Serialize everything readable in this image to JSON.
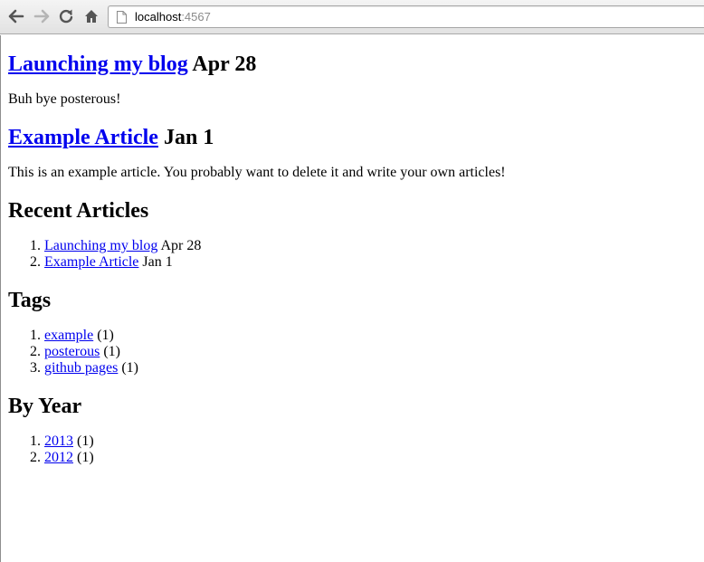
{
  "browser": {
    "url_host": "localhost",
    "url_port": ":4567"
  },
  "articles": [
    {
      "title": "Launching my blog",
      "date": "Apr 28",
      "body": "Buh bye posterous!"
    },
    {
      "title": "Example Article",
      "date": "Jan 1",
      "body": "This is an example article. You probably want to delete it and write your own articles!"
    }
  ],
  "recent": {
    "heading": "Recent Articles",
    "items": [
      {
        "title": "Launching my blog",
        "date": "Apr 28"
      },
      {
        "title": "Example Article",
        "date": "Jan 1"
      }
    ]
  },
  "tags": {
    "heading": "Tags",
    "items": [
      {
        "name": "example",
        "count": "(1)"
      },
      {
        "name": "posterous",
        "count": "(1)"
      },
      {
        "name": "github pages",
        "count": "(1)"
      }
    ]
  },
  "by_year": {
    "heading": "By Year",
    "items": [
      {
        "year": "2013",
        "count": "(1)"
      },
      {
        "year": "2012",
        "count": "(1)"
      }
    ]
  },
  "icons": {
    "back": "back-arrow-icon",
    "forward": "forward-arrow-icon",
    "reload": "reload-icon",
    "home": "home-icon",
    "page": "page-icon"
  },
  "colors": {
    "link": "#0000ee",
    "text": "#000000",
    "toolbar_top": "#f4f4f4",
    "toolbar_bottom": "#e2e2e2"
  }
}
